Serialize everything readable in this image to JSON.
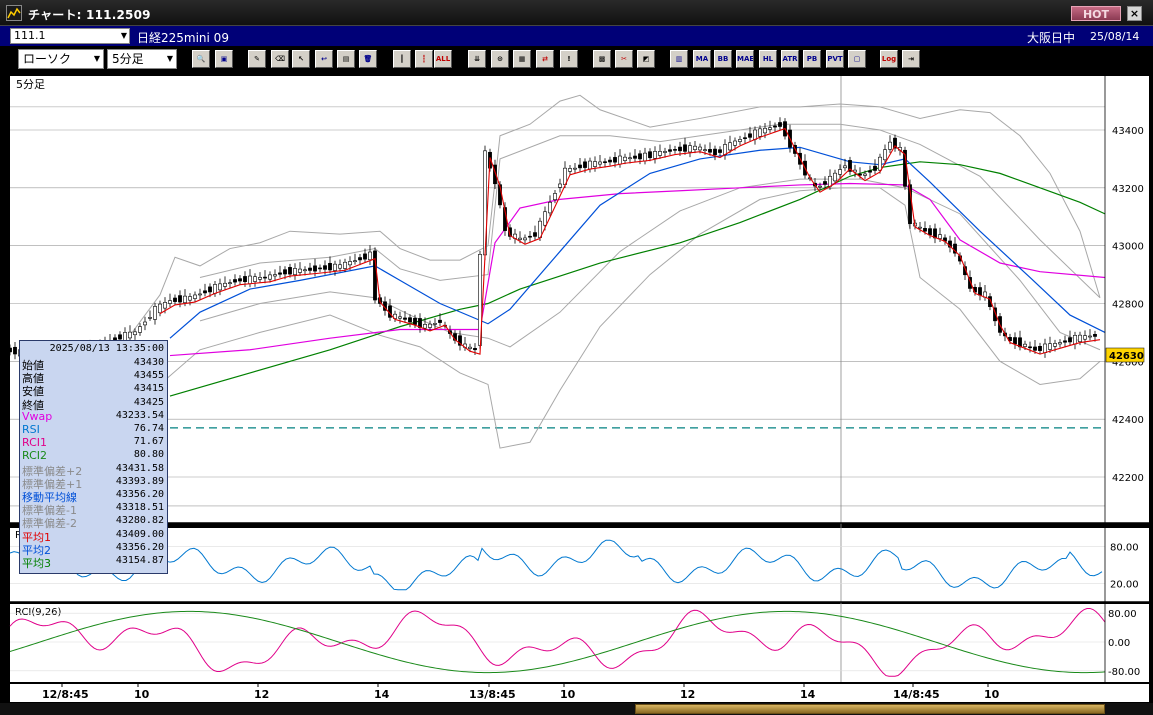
{
  "window": {
    "title": "チャート: 111.2509",
    "hot_label": "HOT",
    "close_glyph": "×"
  },
  "symbol_bar": {
    "code": "111.1",
    "name": "日経225mini 09",
    "session": "大阪日中",
    "date": "25/08/14"
  },
  "toolbar": {
    "chart_type": "ローソク",
    "interval": "5分足",
    "buttons": [
      {
        "id": "zoom",
        "glyph": "🔍",
        "icon": "magnifier-icon",
        "class": ""
      },
      {
        "id": "window",
        "glyph": "▣",
        "icon": "window-icon",
        "class": "blue"
      },
      {
        "id": "pen",
        "glyph": "✎",
        "icon": "pen-icon",
        "class": ""
      },
      {
        "id": "eraser",
        "glyph": "⌫",
        "icon": "eraser-icon",
        "class": ""
      },
      {
        "id": "cursor",
        "glyph": "↖",
        "icon": "cursor-icon",
        "class": ""
      },
      {
        "id": "undo",
        "glyph": "↩",
        "icon": "undo-icon",
        "class": "blue"
      },
      {
        "id": "doc",
        "glyph": "▤",
        "icon": "document-icon",
        "class": ""
      },
      {
        "id": "trash",
        "glyph": "🗑",
        "icon": "trash-icon",
        "class": "blue"
      },
      {
        "id": "candle1",
        "glyph": "┃",
        "icon": "candle-icon",
        "class": ""
      },
      {
        "id": "candle2",
        "glyph": "┇",
        "icon": "candles-icon",
        "class": "red"
      },
      {
        "id": "all",
        "glyph": "ALL",
        "icon": "all-icon",
        "class": "red"
      },
      {
        "id": "fit",
        "glyph": "⇊",
        "icon": "fit-icon",
        "class": ""
      },
      {
        "id": "search",
        "glyph": "⊙",
        "icon": "search-icon",
        "class": ""
      },
      {
        "id": "bars",
        "glyph": "▦",
        "icon": "bars-icon",
        "class": ""
      },
      {
        "id": "arrows",
        "glyph": "⇄",
        "icon": "arrows-icon",
        "class": "red"
      },
      {
        "id": "info",
        "glyph": "!",
        "icon": "info-icon",
        "class": ""
      },
      {
        "id": "grid",
        "glyph": "▩",
        "icon": "grid-icon",
        "class": ""
      },
      {
        "id": "tool",
        "glyph": "✂",
        "icon": "tool-icon",
        "class": "red"
      },
      {
        "id": "palette",
        "glyph": "◩",
        "icon": "palette-icon",
        "class": ""
      },
      {
        "id": "list",
        "glyph": "▥",
        "icon": "list-icon",
        "class": "blue"
      },
      {
        "id": "ma",
        "glyph": "MA",
        "icon": "ma-icon",
        "class": "blue"
      },
      {
        "id": "bb",
        "glyph": "BB",
        "icon": "bb-icon",
        "class": "blue"
      },
      {
        "id": "mae",
        "glyph": "MAE",
        "icon": "mae-icon",
        "class": "blue"
      },
      {
        "id": "hl",
        "glyph": "HL",
        "icon": "hl-icon",
        "class": "blue"
      },
      {
        "id": "atr",
        "glyph": "ATR",
        "icon": "atr-icon",
        "class": "blue"
      },
      {
        "id": "pb",
        "glyph": "PB",
        "icon": "pb-icon",
        "class": "blue"
      },
      {
        "id": "pvt",
        "glyph": "PVT",
        "icon": "pvt-icon",
        "class": "blue"
      },
      {
        "id": "box",
        "glyph": "▢",
        "icon": "box-icon",
        "class": "blue"
      },
      {
        "id": "log",
        "glyph": "Log",
        "icon": "log-icon",
        "class": "red"
      },
      {
        "id": "exit",
        "glyph": "⇥",
        "icon": "exit-icon",
        "class": ""
      }
    ]
  },
  "chart": {
    "panel_label": "5分足",
    "rsi_label": "RSI",
    "rci_label": "RCI(9,26)",
    "current_price": "42630",
    "price_ticks": [
      "43400",
      "43200",
      "43000",
      "42800",
      "42600",
      "42400",
      "42200"
    ],
    "rsi_ticks": [
      "80.00",
      "20.00"
    ],
    "rci_ticks": [
      "80.00",
      "0.00",
      "-80.00"
    ],
    "x_labels": [
      "12/8:45",
      "10",
      "12",
      "14",
      "13/8:45",
      "10",
      "12",
      "14",
      "14/8:45",
      "10"
    ],
    "colors": {
      "background": "#000000",
      "grid": "#9a9a9a",
      "price_axis_bg": "#ffffff",
      "candle": "#000000",
      "ma_short": "#e00000",
      "ma_mid": "#0050d8",
      "ma_long": "#008000",
      "vwap": "#e000e0",
      "bands": "#a8a8a8",
      "rsi": "#0078d0",
      "rci1": "#e0008a",
      "rci2": "#1a8a1a",
      "current_price_tag": "#ffd400",
      "level_line": "#008080"
    }
  },
  "info_panel": {
    "datetime": "2025/08/13  13:35:00",
    "rows": [
      {
        "label": "始値",
        "value": "43430",
        "color": "#000000"
      },
      {
        "label": "高値",
        "value": "43455",
        "color": "#000000"
      },
      {
        "label": "安値",
        "value": "43415",
        "color": "#000000"
      },
      {
        "label": "終値",
        "value": "43425",
        "color": "#000000"
      },
      {
        "label": "Vwap",
        "value": "43233.54",
        "color": "#e000e0"
      },
      {
        "label": "RSI",
        "value": "76.74",
        "color": "#0078d0"
      },
      {
        "label": "RCI1",
        "value": "71.67",
        "color": "#e0008a"
      },
      {
        "label": "RCI2",
        "value": "80.80",
        "color": "#1a8a1a"
      },
      {
        "label": "標準偏差+2",
        "value": "43431.58",
        "color": "#8a8a8a"
      },
      {
        "label": "標準偏差+1",
        "value": "43393.89",
        "color": "#8a8a8a"
      },
      {
        "label": "移動平均線",
        "value": "43356.20",
        "color": "#0050d8"
      },
      {
        "label": "標準偏差-1",
        "value": "43318.51",
        "color": "#8a8a8a"
      },
      {
        "label": "標準偏差-2",
        "value": "43280.82",
        "color": "#8a8a8a"
      },
      {
        "label": "平均1",
        "value": "43409.00",
        "color": "#e00000"
      },
      {
        "label": "平均2",
        "value": "43356.20",
        "color": "#0050d8"
      },
      {
        "label": "平均3",
        "value": "43154.87",
        "color": "#008000"
      }
    ]
  }
}
